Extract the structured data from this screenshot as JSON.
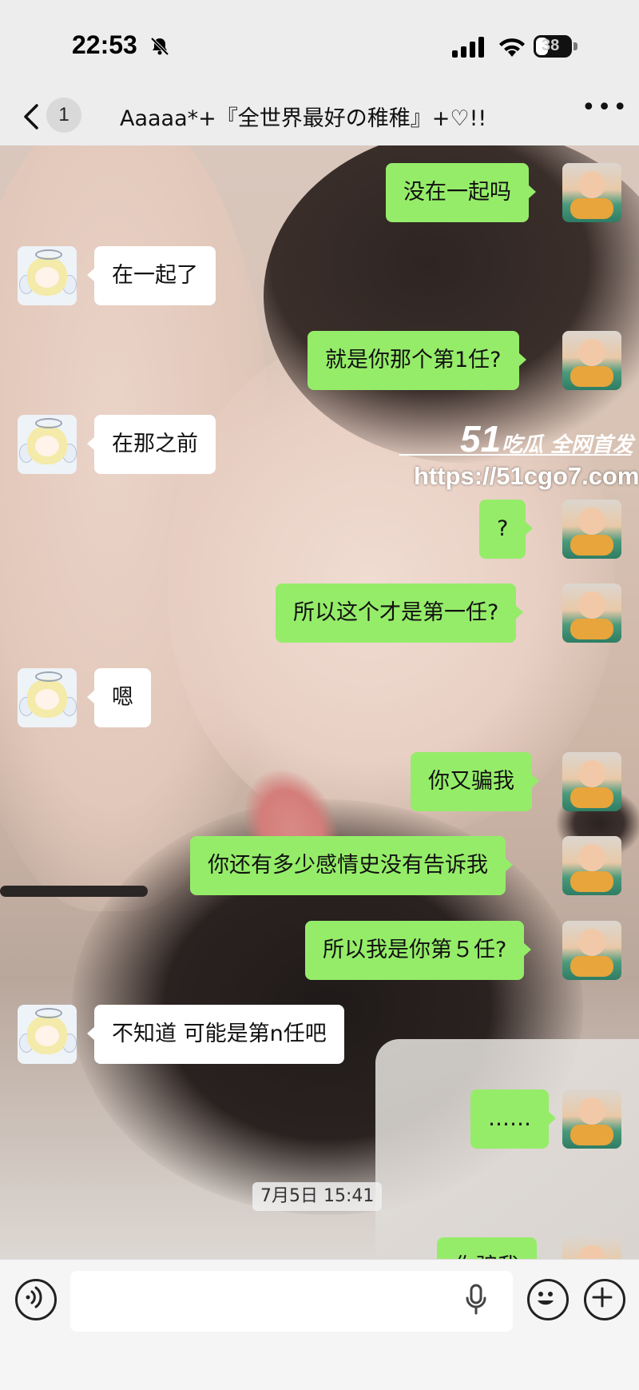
{
  "status_bar": {
    "time": "22:53",
    "battery": "38"
  },
  "header": {
    "back_count": "1",
    "title": "Aaaaa*+『全世界最好の稚稚』+♡!!"
  },
  "messages": [
    {
      "side": "me",
      "text": "没在一起吗"
    },
    {
      "side": "her",
      "text": "在一起了"
    },
    {
      "side": "me",
      "text": "就是你那个第1任?"
    },
    {
      "side": "her",
      "text": "在那之前"
    },
    {
      "side": "me",
      "text": "?"
    },
    {
      "side": "me",
      "text": "所以这个才是第一任?"
    },
    {
      "side": "her",
      "text": "嗯"
    },
    {
      "side": "me",
      "text": "你又骗我"
    },
    {
      "side": "me",
      "text": "你还有多少感情史没有告诉我"
    },
    {
      "side": "me",
      "text": "所以我是你第５任?"
    },
    {
      "side": "her",
      "text": "不知道 可能是第n任吧"
    },
    {
      "side": "me",
      "text": "……"
    },
    {
      "side": "me",
      "text": "你骗我"
    }
  ],
  "timestamp": "7月5日 15:41",
  "watermark": {
    "logo": "51",
    "logo_text": "吃瓜 全网首发",
    "url": "https://51cgo7.com"
  },
  "colors": {
    "me_bubble": "#95ec69",
    "her_bubble": "#ffffff",
    "chrome": "#ededed"
  },
  "icons": [
    "bell-muted-icon",
    "signal-icon",
    "wifi-icon",
    "battery-icon",
    "back-icon",
    "more-icon",
    "voice-icon",
    "mic-icon",
    "emoji-icon",
    "plus-icon"
  ]
}
